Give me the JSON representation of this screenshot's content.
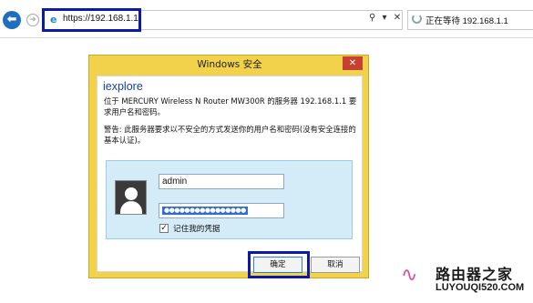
{
  "browser": {
    "back_glyph": "⬅",
    "forward_glyph": "➔",
    "address": "https://192.168.1.1/",
    "address_controls": "⚲ ▾ ✕",
    "tab_title": "正在等待 192.168.1.1",
    "icons": [
      "back-arrow-icon",
      "forward-arrow-icon",
      "ie-page-icon",
      "search-icon",
      "dropdown-icon",
      "close-icon",
      "loading-spinner-icon"
    ]
  },
  "dialog": {
    "title": "Windows 安全",
    "close_glyph": "✕",
    "app_name": "iexplore",
    "message": "位于 MERCURY Wireless N Router MW300R 的服务器 192.168.1.1 要求用户名和密码。",
    "warning": "警告: 此服务器要求以不安全的方式发送你的用户名和密码(没有安全连接的基本认证)。",
    "username_value": "admin",
    "password_mask": "●●●●●●●●●●●●●●●●",
    "remember_checked": true,
    "remember_glyph": "✓",
    "remember_label": "记住我的凭据",
    "ok_label": "确定",
    "cancel_label": "取消"
  },
  "colors": {
    "dialog_frame": "#f1d24a",
    "highlight_box": "#0c1aa8",
    "credential_panel": "#d4ecf8",
    "back_button": "#1e6fc0",
    "close_button": "#c84031",
    "app_name": "#1a3f9a"
  },
  "watermark": {
    "logo_glyph": "∿",
    "title": "路由器之家",
    "url": "LUYOUQI520.COM"
  }
}
